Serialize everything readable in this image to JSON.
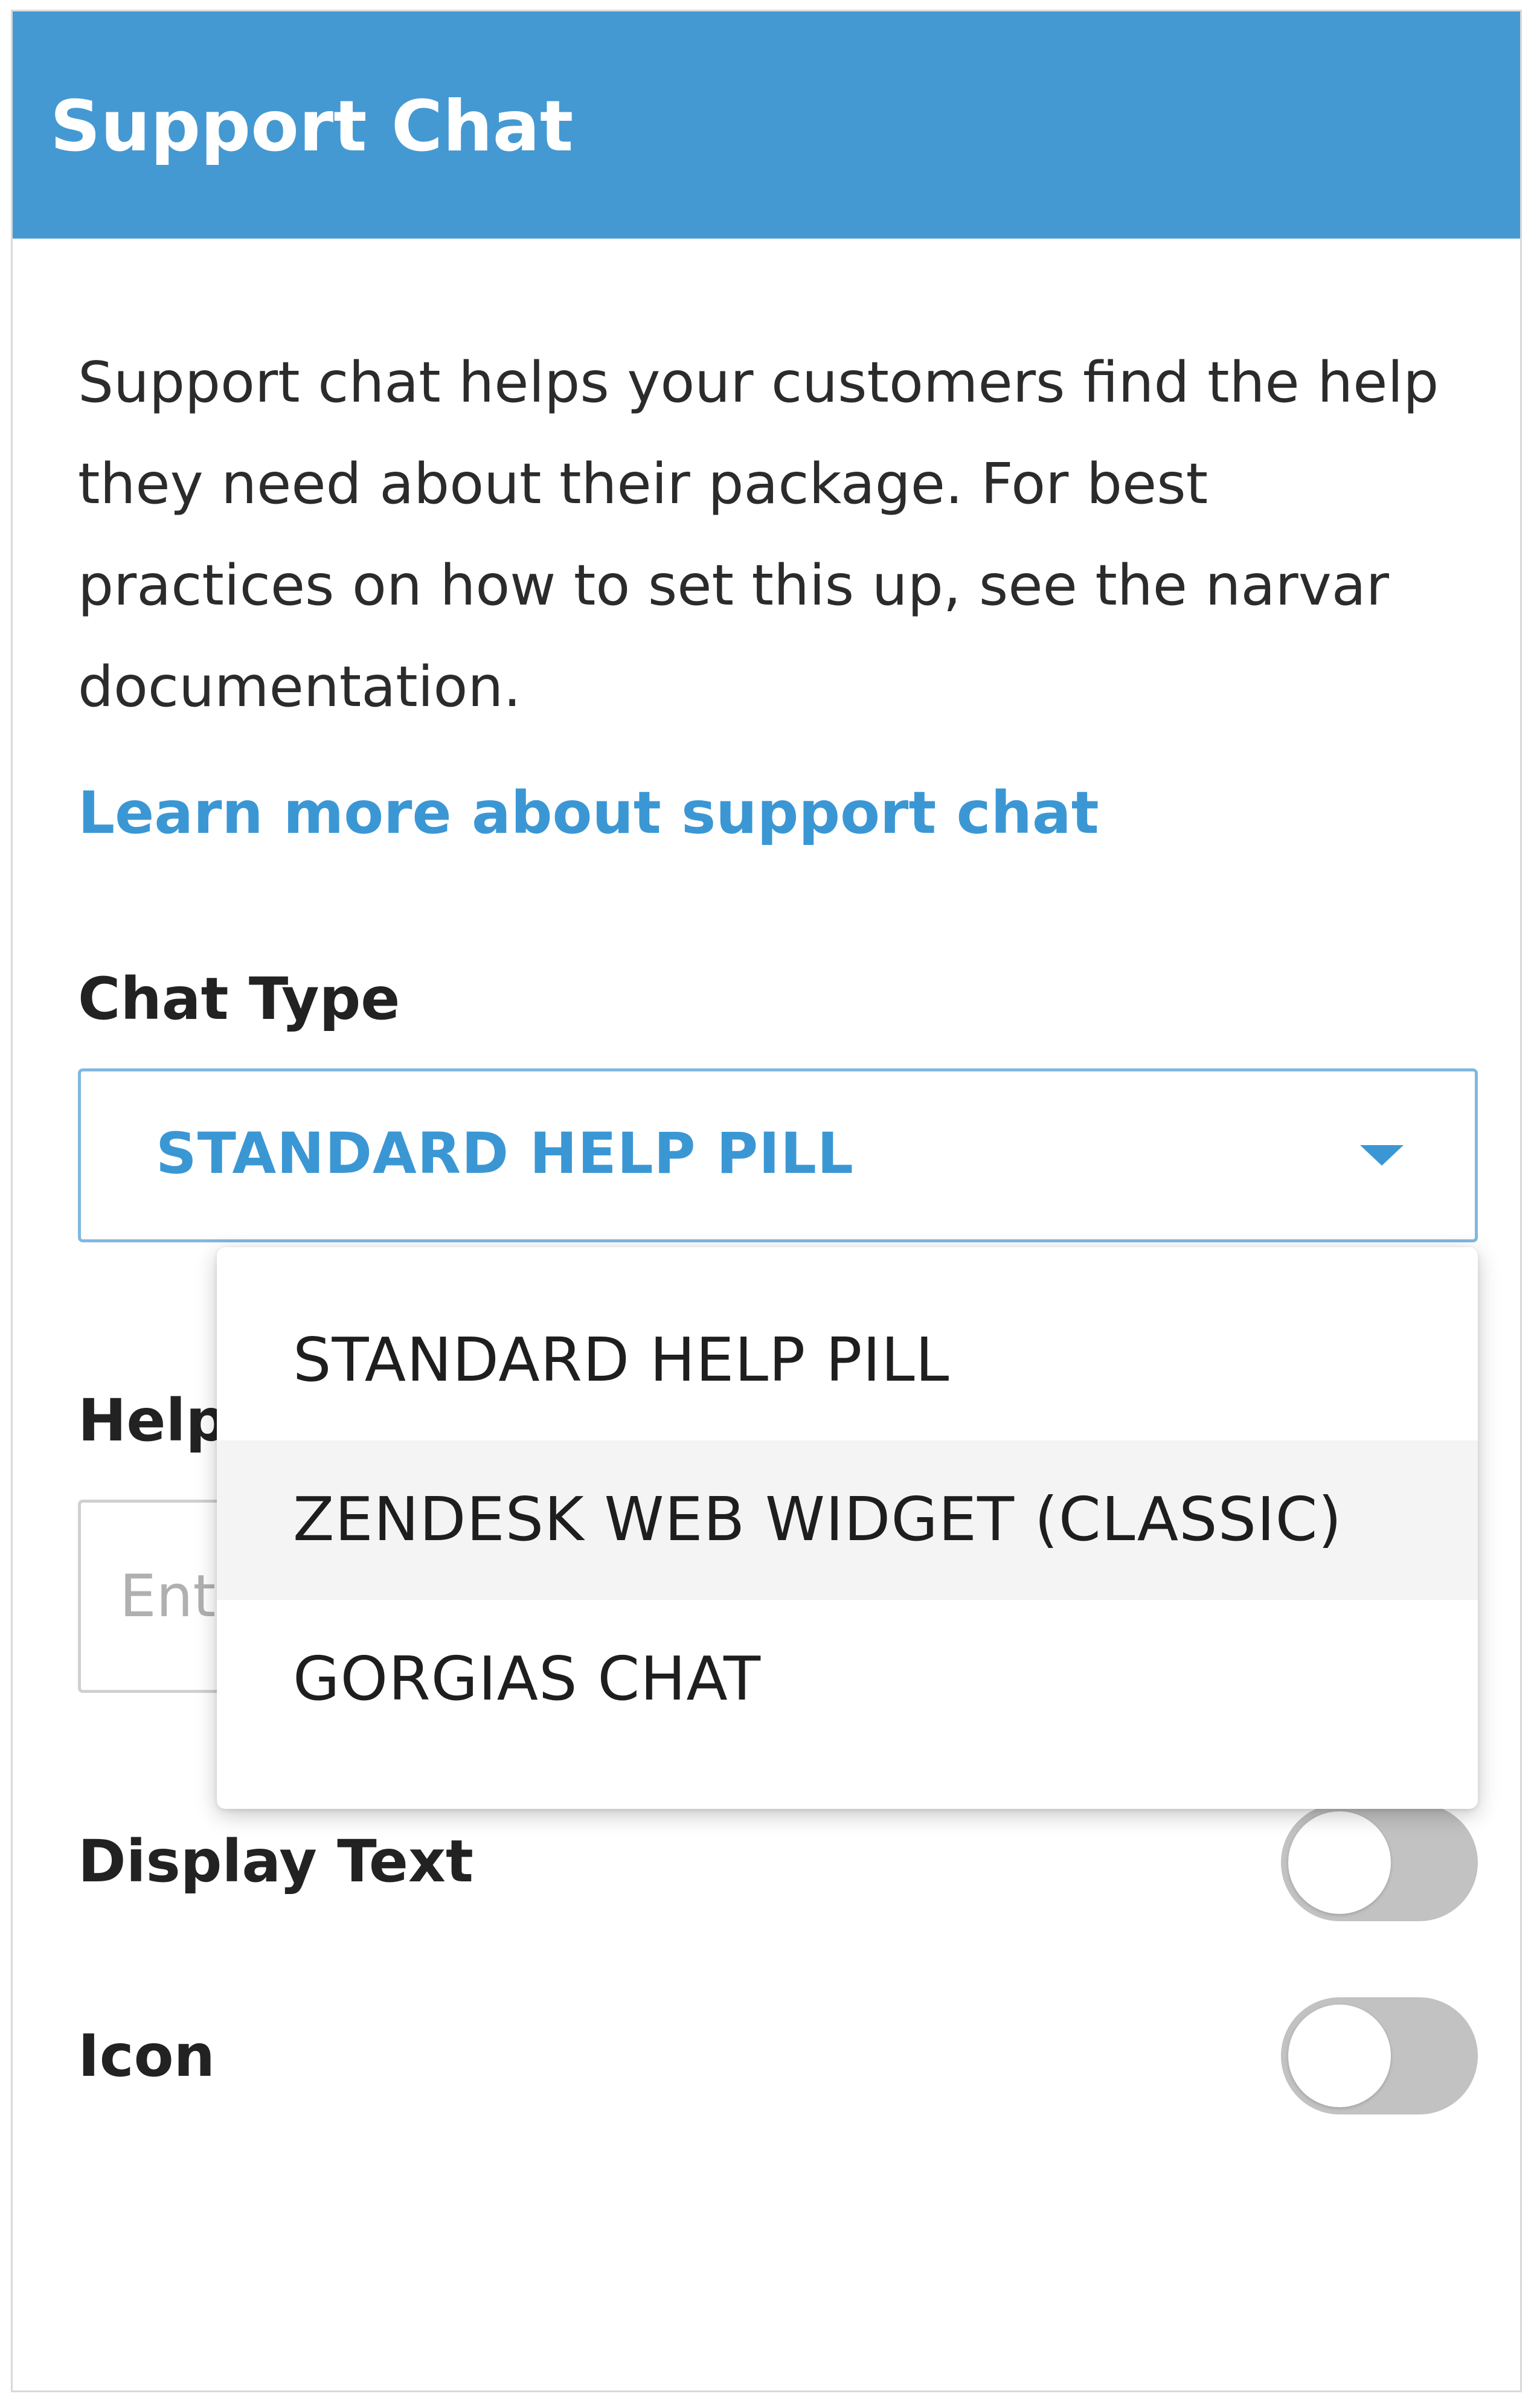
{
  "header": {
    "title": "Support Chat"
  },
  "description": "Support chat helps your customers find the help they need about their package. For best practices on how to set this up, see the narvar documentation.",
  "learn_more_link": "Learn more about support chat",
  "chat_type": {
    "label": "Chat Type",
    "selected": "STANDARD HELP PILL",
    "options": [
      "STANDARD HELP PILL",
      "ZENDESK WEB WIDGET (CLASSIC)",
      "GORGIAS CHAT"
    ]
  },
  "help_field": {
    "label": "Help",
    "placeholder": "Ent"
  },
  "display_text": {
    "label": "Display Text",
    "enabled": false
  },
  "icon_setting": {
    "label": "Icon",
    "enabled": false
  },
  "colors": {
    "header_bg": "#4499d2",
    "accent": "#3b97d4",
    "toggle_off": "#c2c2c2"
  }
}
